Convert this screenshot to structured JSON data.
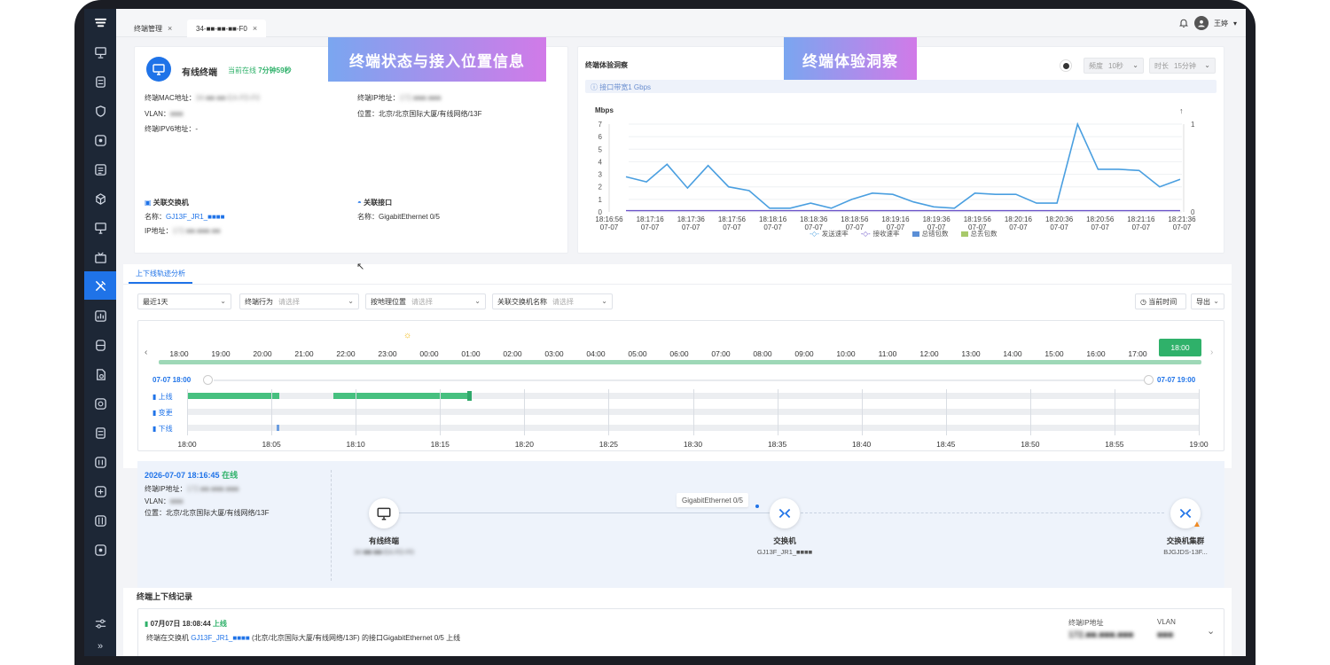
{
  "tabs": [
    {
      "label": "终端管理"
    },
    {
      "label": "34-■■-■■-■■-F0"
    }
  ],
  "header": {
    "user_name": "王婷"
  },
  "banners": {
    "status": "终端状态与接入位置信息",
    "insight": "终端体验洞察"
  },
  "terminal": {
    "type": "有线终端",
    "online_prefix": "当前在线",
    "online_duration": "7分钟59秒",
    "mac_label": "终端MAC地址：",
    "mac_value": "34-■■-■■-EA-FD-F0",
    "vlan_label": "VLAN：",
    "vlan_value": "■■■",
    "ipv6_label": "终端IPV6地址：",
    "ipv6_value": "-",
    "ip_label": "终端IP地址：",
    "ip_value": "172.■■■.■■■",
    "location_label": "位置：",
    "location_value": "北京/北京国际大厦/有线网络/13F"
  },
  "switch": {
    "title": "关联交换机",
    "name_label": "名称：",
    "name_value": "GJ13F_JR1_■■■■",
    "ip_label": "IP地址：",
    "ip_value": "172.■■.■■■.■■"
  },
  "port": {
    "title": "关联接口",
    "name_label": "名称：",
    "name_value": "GigabitEthernet 0/5"
  },
  "insight": {
    "title": "终端体验洞察",
    "bandwidth": "接口带宽1 Gbps",
    "freq_label": "频度",
    "freq_value": "10秒",
    "dur_label": "时长",
    "dur_value": "15分钟"
  },
  "chart_data": {
    "type": "line",
    "ylabel": "Mbps",
    "ylim": [
      0,
      7
    ],
    "y2lim": [
      0,
      1
    ],
    "yticks": [
      "0",
      "1",
      "2",
      "3",
      "4",
      "5",
      "6",
      "7"
    ],
    "y2ticks": [
      "0",
      "1"
    ],
    "x_labels": [
      [
        "18:16:56",
        "07-07"
      ],
      [
        "18:17:16",
        "07-07"
      ],
      [
        "18:17:36",
        "07-07"
      ],
      [
        "18:17:56",
        "07-07"
      ],
      [
        "18:18:16",
        "07-07"
      ],
      [
        "18:18:36",
        "07-07"
      ],
      [
        "18:18:56",
        "07-07"
      ],
      [
        "18:19:16",
        "07-07"
      ],
      [
        "18:19:36",
        "07-07"
      ],
      [
        "18:19:56",
        "07-07"
      ],
      [
        "18:20:16",
        "07-07"
      ],
      [
        "18:20:36",
        "07-07"
      ],
      [
        "18:20:56",
        "07-07"
      ],
      [
        "18:21:16",
        "07-07"
      ],
      [
        "18:21:36",
        "07-07"
      ]
    ],
    "series": [
      {
        "name": "发送速率",
        "color": "#4a9fe0",
        "values": [
          2.8,
          2.4,
          3.8,
          1.9,
          3.7,
          2.0,
          1.7,
          0.3,
          0.3,
          0.7,
          0.3,
          1.0,
          1.5,
          1.4,
          0.8,
          0.4,
          0.3,
          1.5,
          1.4,
          1.4,
          0.7,
          0.7,
          7.0,
          3.4,
          3.4,
          3.3,
          2.0,
          2.6
        ]
      },
      {
        "name": "接收速率",
        "color": "#6a52c8",
        "values": [
          0.1,
          0.1,
          0.1,
          0.1,
          0.1,
          0.1,
          0.1,
          0.1,
          0.1,
          0.1,
          0.1,
          0.1,
          0.1,
          0.1,
          0.1,
          0.1,
          0.1,
          0.1,
          0.1,
          0.1,
          0.1,
          0.1,
          0.1,
          0.1,
          0.1,
          0.1,
          0.1,
          0.1
        ]
      },
      {
        "name": "总错包数",
        "color": "#5b8fd6",
        "values": []
      },
      {
        "name": "总丢包数",
        "color": "#a8c96a",
        "values": []
      }
    ]
  },
  "trace": {
    "tab": "上下线轨迹分析",
    "filters": [
      {
        "label": "最近1天",
        "ph": ""
      },
      {
        "label": "终端行为",
        "ph": "请选择"
      },
      {
        "label": "按地理位置",
        "ph": "请选择"
      },
      {
        "label": "关联交换机名称",
        "ph": "请选择"
      }
    ],
    "now_btn": "当前时间",
    "export_btn": "导出",
    "hours": [
      "18:00",
      "19:00",
      "20:00",
      "21:00",
      "22:00",
      "23:00",
      "00:00",
      "01:00",
      "02:00",
      "03:00",
      "04:00",
      "05:00",
      "06:00",
      "07:00",
      "08:00",
      "09:00",
      "10:00",
      "11:00",
      "12:00",
      "13:00",
      "14:00",
      "15:00",
      "16:00",
      "17:00",
      "18:00"
    ],
    "range_start": "07-07 18:00",
    "range_end": "07-07 19:00",
    "rows": [
      "上线",
      "变更",
      "下线"
    ],
    "axis": [
      "18:00",
      "18:05",
      "18:10",
      "18:15",
      "18:20",
      "18:25",
      "18:30",
      "18:35",
      "18:40",
      "18:45",
      "18:50",
      "18:55",
      "19:00"
    ]
  },
  "detail": {
    "time": "2026-07-07 18:16:45",
    "status": "在线",
    "ip_label": "终端IP地址：",
    "ip_value": "172.■■.■■■.■■■",
    "vlan_label": "VLAN：",
    "vlan_value": "■■■",
    "loc_label": "位置：",
    "loc_value": "北京/北京国际大厦/有线网络/13F",
    "link_label": "GigabitEthernet 0/5",
    "nodes": [
      {
        "title": "有线终端",
        "sub": "34-■■-■■-EA-FD-F0"
      },
      {
        "title": "交换机",
        "sub": "GJ13F_JR1_■■■■"
      },
      {
        "title": "交换机集群",
        "sub": "BJGJDS-13F..."
      }
    ]
  },
  "records": {
    "title": "终端上下线记录",
    "item": {
      "time": "07月07日 18:08:44",
      "status": "上线",
      "desc_pre": "终端在交换机",
      "switch": "GJ13F_JR1_■■■■",
      "desc_post": "(北京/北京国际大厦/有线网络/13F) 的接口GigabitEthernet 0/5 上线",
      "ip_label": "终端IP地址",
      "ip_value": "172.■■.■■■.■■■",
      "vlan_label": "VLAN",
      "vlan_value": "■■■"
    }
  }
}
